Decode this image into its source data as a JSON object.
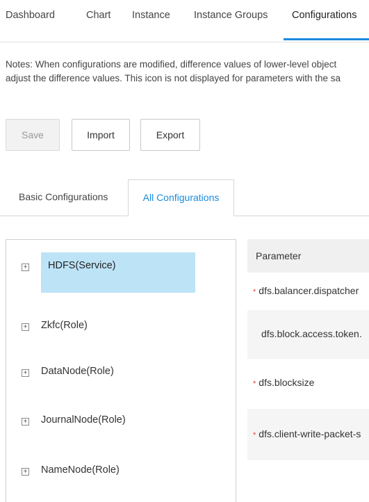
{
  "topnav": {
    "tabs": [
      {
        "label": "Dashboard"
      },
      {
        "label": "Chart"
      },
      {
        "label": "Instance"
      },
      {
        "label": "Instance Groups"
      },
      {
        "label": "Configurations"
      }
    ],
    "active_index": 4
  },
  "notes": {
    "line1": "Notes: When configurations are modified, difference values of lower-level object",
    "line2": "adjust the difference values. This icon is not displayed for parameters with the sa"
  },
  "toolbar": {
    "save_label": "Save",
    "import_label": "Import",
    "export_label": "Export"
  },
  "config_tabs": {
    "basic_label": "Basic Configurations",
    "all_label": "All Configurations",
    "active": "all"
  },
  "tree": {
    "items": [
      {
        "label": "HDFS(Service)",
        "expander": "+"
      },
      {
        "label": "Zkfc(Role)",
        "expander": "+"
      },
      {
        "label": "DataNode(Role)",
        "expander": "+"
      },
      {
        "label": "JournalNode(Role)",
        "expander": "+"
      },
      {
        "label": "NameNode(Role)",
        "expander": "+"
      }
    ],
    "selected_index": 0
  },
  "param_table": {
    "header": "Parameter",
    "rows": [
      {
        "name": "dfs.balancer.dispatcher",
        "required": true
      },
      {
        "name": "dfs.block.access.token.",
        "required": false
      },
      {
        "name": "dfs.blocksize",
        "required": true
      },
      {
        "name": "dfs.client-write-packet-s",
        "required": true
      }
    ],
    "required_marker": "*"
  },
  "colors": {
    "accent": "#1a8be0",
    "selected_bg": "#bde3f7",
    "required": "#e5412d"
  }
}
